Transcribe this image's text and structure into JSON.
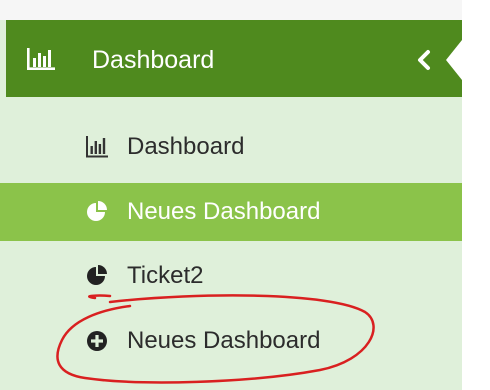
{
  "sidebar": {
    "header": {
      "title": "Dashboard",
      "icon": "bar-chart-icon",
      "collapse_icon": "chevron-left-icon"
    },
    "items": [
      {
        "label": "Dashboard",
        "icon": "bar-chart-icon",
        "active": false
      },
      {
        "label": "Neues Dashboard",
        "icon": "pie-chart-icon",
        "active": true
      },
      {
        "label": "Ticket2",
        "icon": "pie-chart-icon",
        "active": false
      },
      {
        "label": "Neues Dashboard",
        "icon": "plus-circle-icon",
        "active": false
      }
    ]
  },
  "colors": {
    "header_bg": "#4f8a1e",
    "sidebar_bg": "#dff0da",
    "active_bg": "#8bc34a",
    "annotation": "#d92020"
  }
}
